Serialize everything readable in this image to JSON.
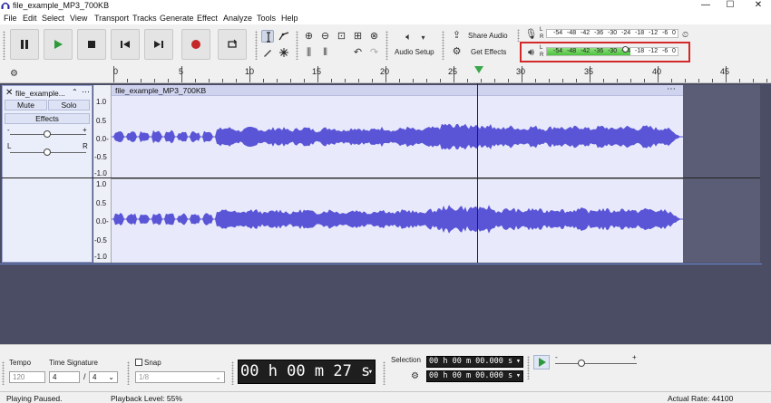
{
  "window": {
    "title": "file_example_MP3_700KB",
    "minimize": "—",
    "maximize": "☐",
    "close": "✕"
  },
  "menu": [
    "File",
    "Edit",
    "Select",
    "View",
    "Transport",
    "Tracks",
    "Generate",
    "Effect",
    "Analyze",
    "Tools",
    "Help"
  ],
  "toolbar": {
    "audio_setup": "Audio Setup",
    "share_audio": "Share Audio",
    "get_effects": "Get Effects"
  },
  "meters": {
    "record_scale": [
      "-54",
      "-48",
      "-42",
      "-36",
      "-30",
      "-24",
      "-18",
      "-12",
      "-6",
      "0"
    ],
    "playback_scale": [
      "-54",
      "-48",
      "-42",
      "-36",
      "-30",
      "-24",
      "-18",
      "-12",
      "-6",
      "0"
    ],
    "record_channels": [
      "L",
      "R"
    ],
    "playback_channels": [
      "L",
      "R"
    ],
    "playback_level_fraction": 0.55,
    "highlight_color": "#d32828"
  },
  "ruler": {
    "labels": [
      "0",
      "5",
      "10",
      "15",
      "20",
      "25",
      "30",
      "35",
      "40",
      "45"
    ]
  },
  "track": {
    "name": "file_example...",
    "clip_name": "file_example_MP3_700KB",
    "mute": "Mute",
    "solo": "Solo",
    "effects": "Effects",
    "pan_left": "L",
    "pan_right": "R",
    "gain_minus": "-",
    "gain_plus": "+",
    "waveform_color": "#5a55d6",
    "vruler_top": [
      "1.0",
      "0.5",
      "0.0-",
      "-0.5",
      "-1.0"
    ],
    "vruler_bottom": [
      "1.0",
      "0.5",
      "0.0-",
      "-0.5",
      "-1.0"
    ]
  },
  "bottom": {
    "tempo_label": "Tempo",
    "tempo_value": "120",
    "timesig_label": "Time Signature",
    "timesig_num": "4",
    "timesig_sep": "/",
    "timesig_den": "4",
    "snap_label": "Snap",
    "snap_value": "1/8",
    "time_display": "00 h 00 m 27 s",
    "selection_label": "Selection",
    "selection_start": "00 h 00 m 00.000 s",
    "selection_end": "00 h 00 m 00.000 s"
  },
  "status": {
    "state": "Playing Paused.",
    "playback_level": "Playback Level: 55%",
    "actual_rate": "Actual Rate: 44100"
  }
}
